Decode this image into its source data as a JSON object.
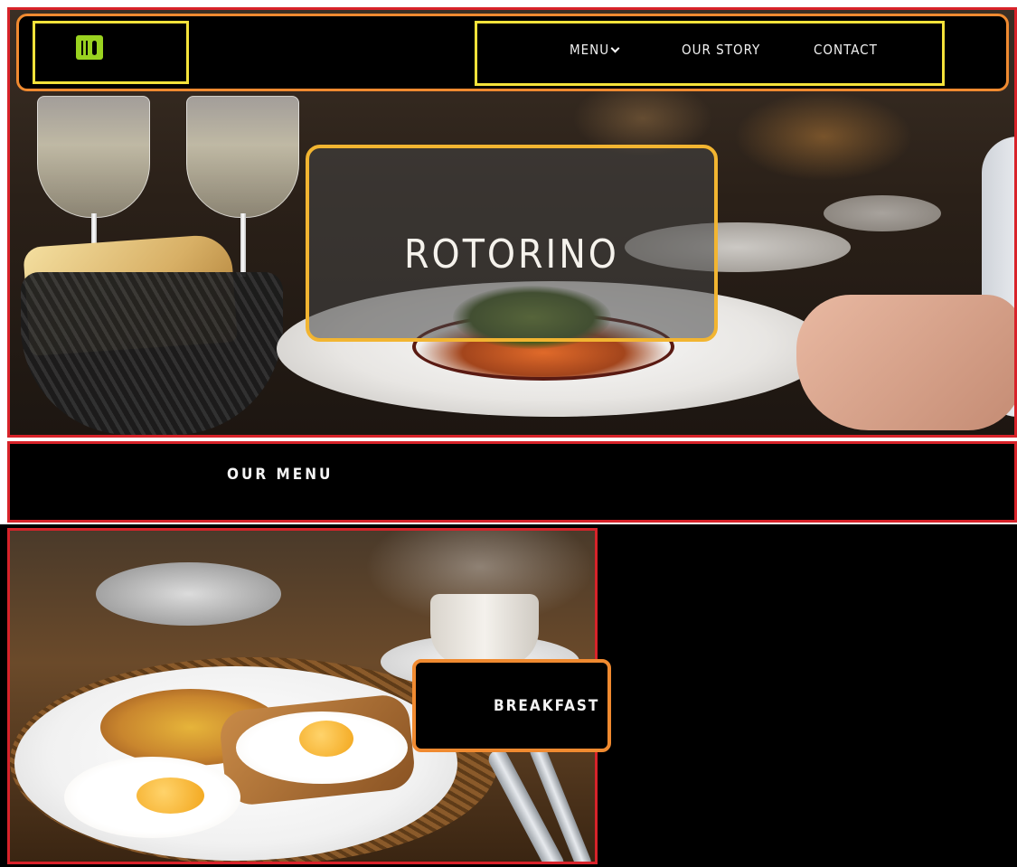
{
  "brand": {
    "logo_icon": "fork-knife-icon",
    "accent_color": "#9ad320"
  },
  "nav": {
    "items": [
      {
        "label": "MENU",
        "has_dropdown": true,
        "icon": "chevron-down-icon"
      },
      {
        "label": "OUR STORY"
      },
      {
        "label": "CONTACT"
      }
    ]
  },
  "hero": {
    "title": "ROTORINO"
  },
  "menu_section": {
    "title": "OUR MENU",
    "categories": [
      {
        "label": "BREAKFAST"
      }
    ]
  },
  "colors": {
    "highlight_red": "#d8232a",
    "highlight_orange": "#f08a30",
    "highlight_yellow": "#f4e23a",
    "highlight_gold": "#f2b531"
  }
}
